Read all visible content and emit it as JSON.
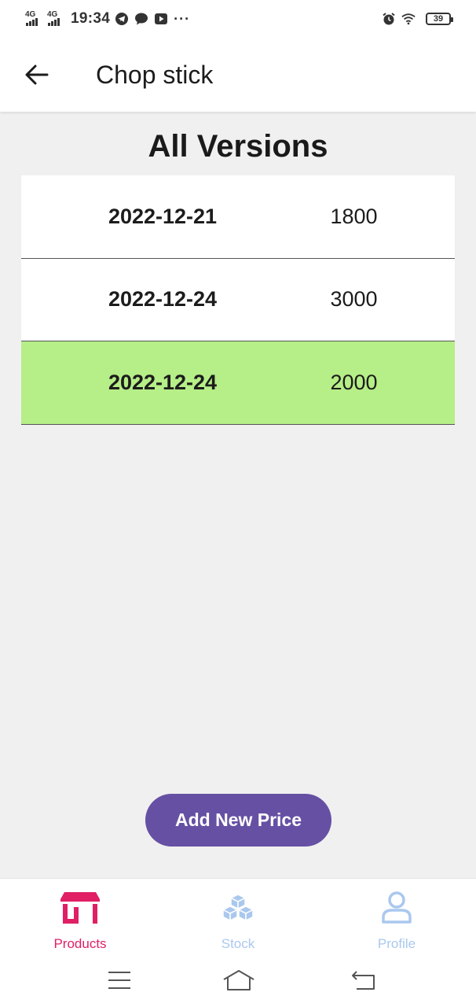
{
  "status_bar": {
    "sim1": "4G",
    "sim2": "4G",
    "time": "19:34",
    "icons": [
      "telegram-icon",
      "message-icon",
      "youtube-icon",
      "more-dots-icon",
      "alarm-icon",
      "wifi-icon",
      "battery-icon"
    ],
    "more": "···",
    "battery": "39"
  },
  "app_bar": {
    "back_icon": "arrow-left-icon",
    "title": "Chop stick"
  },
  "main": {
    "section_title": "All Versions",
    "versions": [
      {
        "date": "2022-12-21",
        "price": "1800",
        "highlighted": false
      },
      {
        "date": "2022-12-24",
        "price": "3000",
        "highlighted": false
      },
      {
        "date": "2022-12-24",
        "price": "2000",
        "highlighted": true
      }
    ],
    "add_button_label": "Add New Price"
  },
  "bottom_nav": {
    "items": [
      {
        "label": "Products",
        "icon": "store-icon",
        "active": true
      },
      {
        "label": "Stock",
        "icon": "boxes-icon",
        "active": false
      },
      {
        "label": "Profile",
        "icon": "person-icon",
        "active": false
      }
    ]
  },
  "system_nav": {
    "buttons": [
      "menu-icon",
      "home-icon",
      "back-icon"
    ]
  },
  "colors": {
    "accent": "#6650a4",
    "highlight_row": "#b6ee87",
    "nav_active": "#e01f65",
    "nav_inactive": "#aac8ee",
    "background": "#f0f0f0"
  }
}
